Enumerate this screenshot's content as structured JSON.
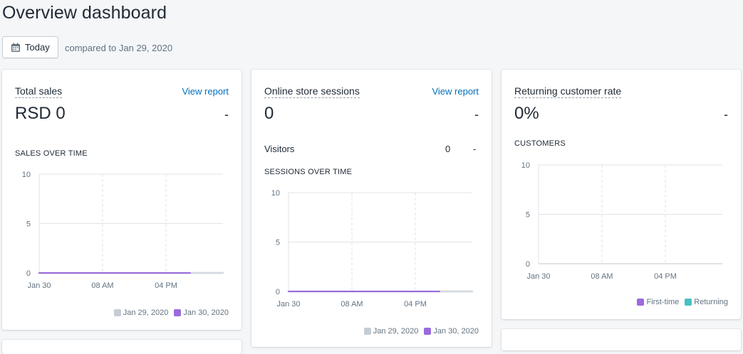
{
  "header": {
    "title": "Overview dashboard",
    "date_button_label": "Today",
    "compare_text": "compared to Jan 29, 2020"
  },
  "cards": {
    "total_sales": {
      "title": "Total sales",
      "link": "View report",
      "value": "RSD 0",
      "change": "-",
      "section": "SALES OVER TIME",
      "legend": [
        "Jan 29, 2020",
        "Jan 30, 2020"
      ]
    },
    "sessions": {
      "title": "Online store sessions",
      "link": "View report",
      "value": "0",
      "change": "-",
      "visitors_label": "Visitors",
      "visitors_value": "0",
      "visitors_change": "-",
      "section": "SESSIONS OVER TIME",
      "legend": [
        "Jan 29, 2020",
        "Jan 30, 2020"
      ]
    },
    "returning": {
      "title": "Returning customer rate",
      "value": "0%",
      "change": "-",
      "section": "CUSTOMERS",
      "legend": [
        "First-time",
        "Returning"
      ]
    }
  },
  "colors": {
    "previous_period": "#c4cdd5",
    "current_period": "#9c6ade",
    "first_time": "#9c6ade",
    "returning": "#47c1bf",
    "link": "#006fbb"
  },
  "chart_data": [
    {
      "type": "line",
      "section": "SALES OVER TIME",
      "x": [
        "Jan 30",
        "08 AM",
        "04 PM"
      ],
      "ylim": [
        0,
        10
      ],
      "yticks": [
        0,
        5,
        10
      ],
      "series": [
        {
          "name": "Jan 29, 2020",
          "values": [
            0,
            0,
            0
          ]
        },
        {
          "name": "Jan 30, 2020",
          "values": [
            0,
            0,
            0
          ]
        }
      ]
    },
    {
      "type": "line",
      "section": "SESSIONS OVER TIME",
      "x": [
        "Jan 30",
        "08 AM",
        "04 PM"
      ],
      "ylim": [
        0,
        10
      ],
      "yticks": [
        0,
        5,
        10
      ],
      "series": [
        {
          "name": "Jan 29, 2020",
          "values": [
            0,
            0,
            0
          ]
        },
        {
          "name": "Jan 30, 2020",
          "values": [
            0,
            0,
            0
          ]
        }
      ]
    },
    {
      "type": "bar",
      "section": "CUSTOMERS",
      "x": [
        "Jan 30",
        "08 AM",
        "04 PM"
      ],
      "ylim": [
        0,
        10
      ],
      "yticks": [
        0,
        5,
        10
      ],
      "series": [
        {
          "name": "First-time",
          "values": [
            0,
            0,
            0
          ]
        },
        {
          "name": "Returning",
          "values": [
            0,
            0,
            0
          ]
        }
      ]
    }
  ]
}
